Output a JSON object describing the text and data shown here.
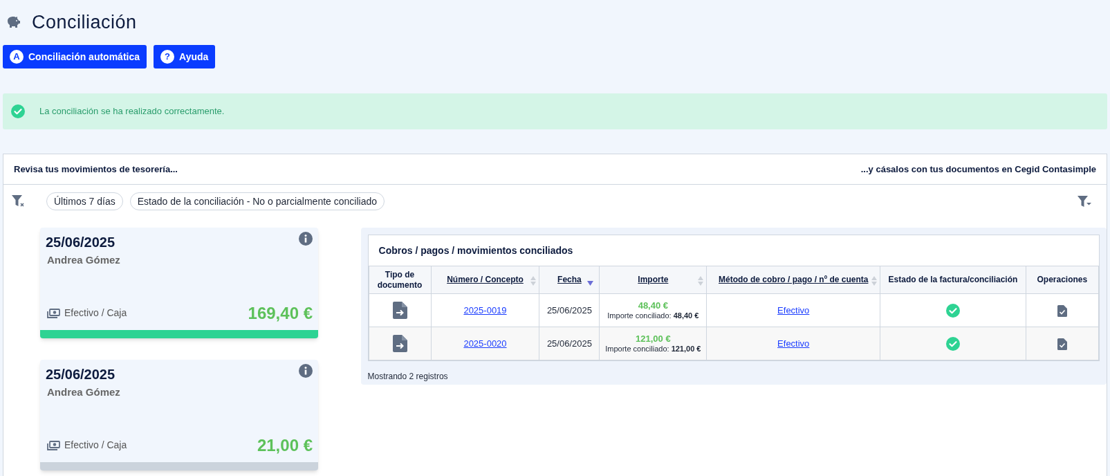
{
  "page_title": "Conciliación",
  "actions": [
    {
      "label": "Conciliación automática",
      "kind": "letter",
      "glyph": "A"
    },
    {
      "label": "Ayuda",
      "kind": "letter",
      "glyph": "?"
    }
  ],
  "alert": {
    "kind": "success",
    "message": "La conciliación se ha realizado correctamente."
  },
  "panel": {
    "left_heading": "Revisa tus movimientos de tesorería...",
    "right_heading": "...y cásalos con tus documentos en Cegid Contasimple",
    "filters": [
      "Últimos 7 días",
      "Estado de la conciliación - No o parcialmente conciliado"
    ],
    "movements": [
      {
        "date": "25/06/2025",
        "name": "Andrea Gómez",
        "method": "Efectivo / Caja",
        "amount": "169,40 €",
        "reconciled": true
      },
      {
        "date": "25/06/2025",
        "name": "Andrea Gómez",
        "method": "Efectivo / Caja",
        "amount": "21,00 €",
        "reconciled": false
      }
    ],
    "table": {
      "title": "Cobros / pagos / movimientos conciliados",
      "columns": [
        {
          "label": "Tipo de documento",
          "kind": "plain"
        },
        {
          "label": "Número / Concepto",
          "kind": "sortable"
        },
        {
          "label": "Fecha",
          "kind": "sorted"
        },
        {
          "label": "Importe",
          "kind": "sortable"
        },
        {
          "label": "Método de cobro / pago / nº de cuenta",
          "kind": "sortable"
        },
        {
          "label": "Estado de la factura/conciliación",
          "kind": "plain"
        },
        {
          "label": "Operaciones",
          "kind": "plain"
        }
      ],
      "rows": [
        {
          "number": "2025-0019",
          "date": "25/06/2025",
          "amount": "48,40 €",
          "reconciled_label": "Importe conciliado:",
          "reconciled_amount": "48,40 €",
          "method": "Efectivo",
          "reconciled": true
        },
        {
          "number": "2025-0020",
          "date": "25/06/2025",
          "amount": "121,00 €",
          "reconciled_label": "Importe conciliado:",
          "reconciled_amount": "121,00 €",
          "method": "Efectivo",
          "reconciled": true
        }
      ],
      "footer": "Mostrando 2 registros"
    }
  }
}
